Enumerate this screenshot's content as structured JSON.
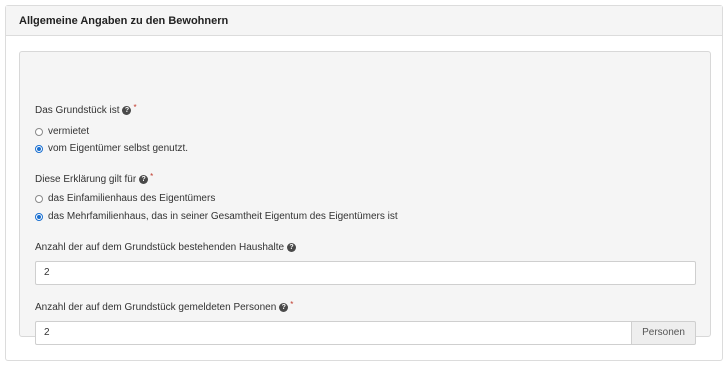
{
  "panel": {
    "title": "Allgemeine Angaben zu den Bewohnern"
  },
  "fields": {
    "grundstueck": {
      "label": "Das Grundstück ist",
      "required_marker": "*",
      "options": [
        {
          "label": "vermietet",
          "checked": false
        },
        {
          "label": "vom Eigentümer selbst genutzt.",
          "checked": true
        }
      ]
    },
    "erklaerung": {
      "label": "Diese Erklärung gilt für",
      "required_marker": "*",
      "options": [
        {
          "label": "das Einfamilienhaus des Eigentümers",
          "checked": false
        },
        {
          "label": "das Mehrfamilienhaus, das in seiner Gesamtheit Eigentum des Eigentümers ist",
          "checked": true
        }
      ]
    },
    "haushalte": {
      "label": "Anzahl der auf dem Grundstück bestehenden Haushalte",
      "value": "2"
    },
    "personen": {
      "label": "Anzahl der auf dem Grundstück gemeldeten Personen",
      "required_marker": "*",
      "value": "2",
      "addon": "Personen"
    }
  },
  "icons": {
    "help": "question-circle-icon",
    "help_glyph": "?"
  },
  "colors": {
    "radio_checked": "#1a6fd0",
    "required": "#c0392b",
    "well_background": "#f5f5f5",
    "heading_background": "#f5f5f5"
  }
}
